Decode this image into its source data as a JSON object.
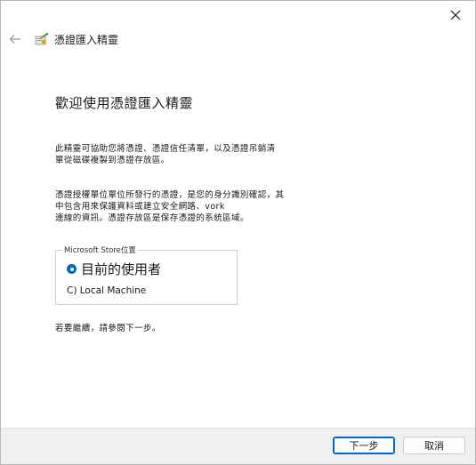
{
  "window": {
    "title": "憑證匯入精靈"
  },
  "heading": "歡迎使用憑證匯入精靈",
  "description": {
    "para1_lines": [
      "此精靈可協助您將憑證、憑證信任清單，以及憑證吊銷清",
      "單從磁碟複製到憑證存放區。"
    ],
    "para2_lines": [
      "憑證授權單位單位所發行的憑證，是您的身分識別確認，其",
      "中包含用來保護資料或建立安全網路、vork",
      "連線的資訊。憑證存放區是保存憑證的系統區域。"
    ]
  },
  "store_location": {
    "legend": "Microsoft Store位置",
    "options": [
      {
        "label": "目前的使用者",
        "selected": true
      },
      {
        "label": "C) Local Machine",
        "selected": false
      }
    ]
  },
  "continue_text": "若要繼續，請參閱下一步。",
  "footer": {
    "next_label": "下一步",
    "cancel_label": "取消"
  },
  "colors": {
    "accent": "#0067c0",
    "footer_bg": "#f0f0f0"
  },
  "icons": [
    "close-icon",
    "back-arrow-icon",
    "certificate-icon"
  ]
}
